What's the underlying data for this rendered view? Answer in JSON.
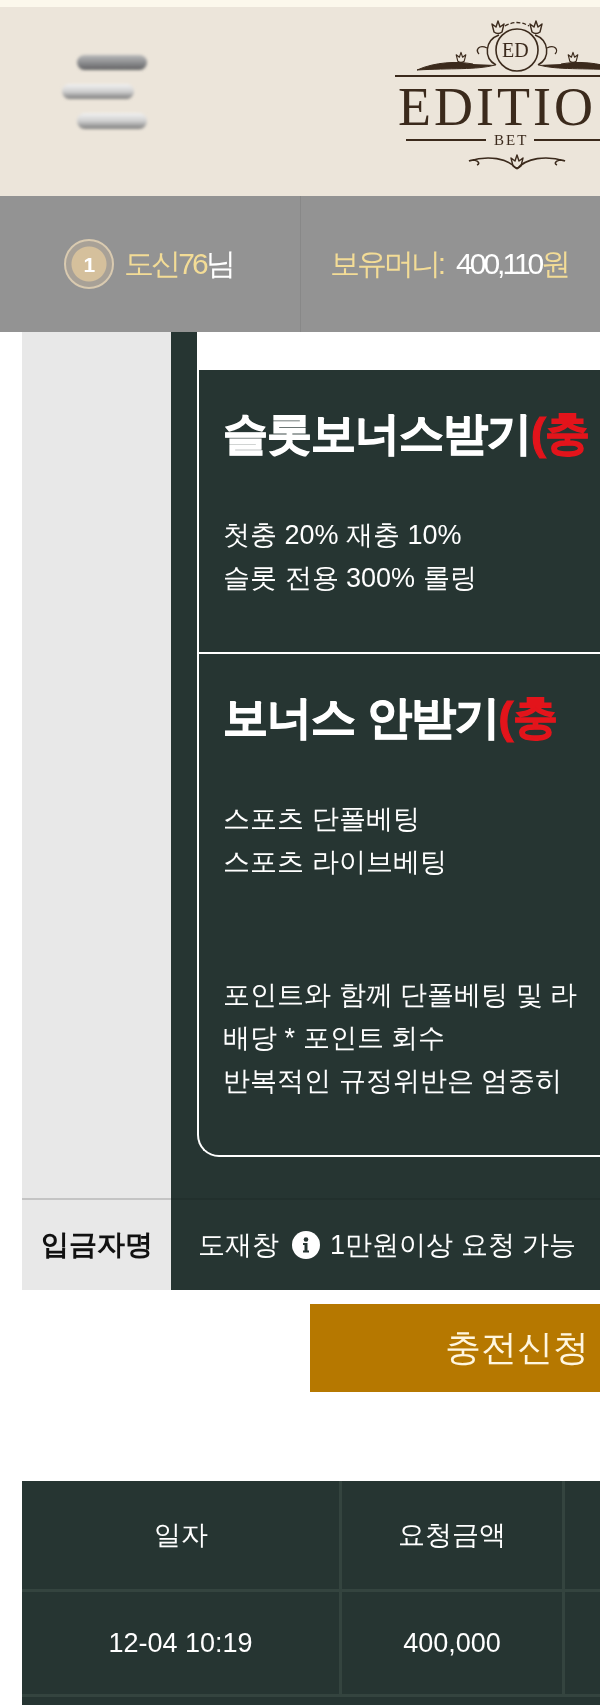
{
  "header": {
    "logo": {
      "monogram": "ED",
      "name": "EDITIO",
      "tagline": "BET"
    }
  },
  "user_bar": {
    "level": "1",
    "name": "도신76",
    "honorific": "님",
    "balance_label": "보유머니:",
    "balance": "400,110",
    "currency": "원"
  },
  "deposit_form": {
    "bonus_options": [
      {
        "title": "슬롯보너스받기",
        "note": "(충",
        "lines": [
          "첫충 20% 재충 10%",
          "슬롯 전용 300% 롤링"
        ]
      },
      {
        "title": "보너스 안받기",
        "note": "(충",
        "lines": [
          "스포츠 단폴베팅",
          "스포츠 라이브베팅"
        ],
        "warnings": [
          "포인트와 함께 단폴베팅 및 라",
          "배당 * 포인트 회수",
          "반복적인 규정위반은 엄중히"
        ]
      }
    ],
    "depositor": {
      "label": "입금자명",
      "value": "도재창",
      "hint": "1만원이상 요청 가능"
    }
  },
  "submit_button": "충전신청",
  "history_table": {
    "columns": [
      "일자",
      "요청금액"
    ],
    "rows": [
      [
        "12-04 10:19",
        "400,000"
      ]
    ]
  }
}
